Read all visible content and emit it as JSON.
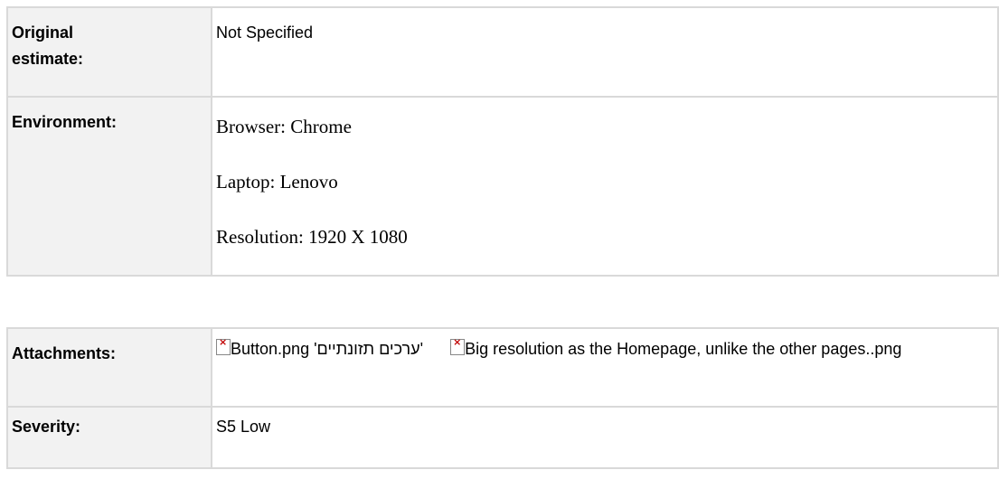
{
  "table1": {
    "original_estimate": {
      "label_line1": "Original",
      "label_line2": "estimate:",
      "value": "Not Specified"
    },
    "environment": {
      "label": "Environment:",
      "lines": [
        "Browser: Chrome",
        "Laptop: Lenovo",
        "Resolution: 1920 X 1080"
      ]
    }
  },
  "table2": {
    "attachments": {
      "label": "Attachments:",
      "files": [
        {
          "name": "'ערכים תזונתיים' Button.png",
          "icon": "broken-image-icon"
        },
        {
          "name": "Big resolution as the Homepage, unlike the other pages..png",
          "icon": "broken-image-icon"
        }
      ]
    },
    "severity": {
      "label": "Severity:",
      "value": "S5 Low"
    }
  }
}
